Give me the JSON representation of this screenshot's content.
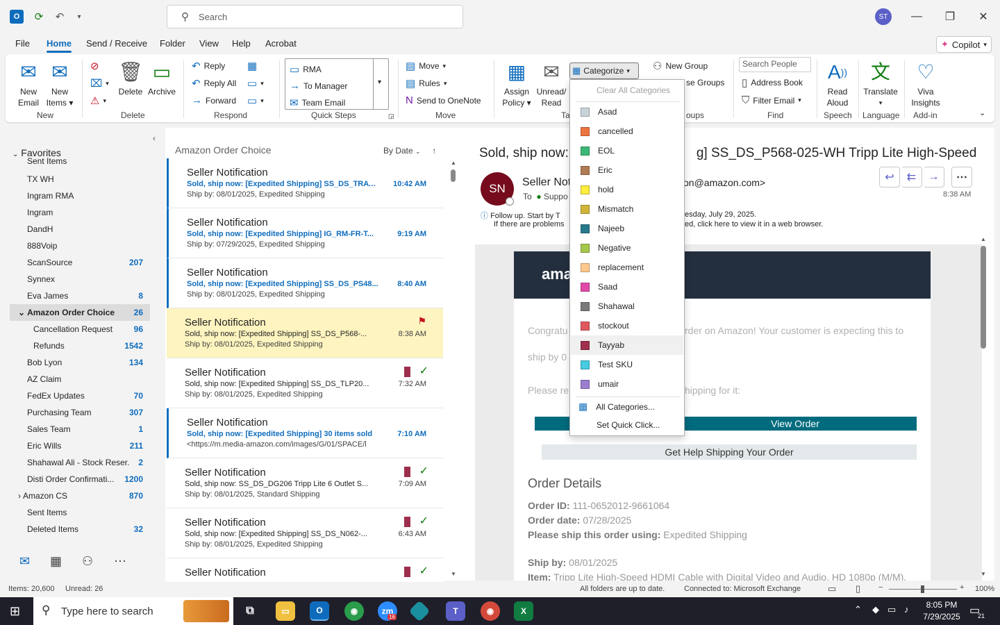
{
  "titlebar": {
    "search_placeholder": "Search",
    "avatar_initials": "ST"
  },
  "menu_tabs": [
    "File",
    "Home",
    "Send / Receive",
    "Folder",
    "View",
    "Help",
    "Acrobat"
  ],
  "copilot_label": "Copilot",
  "ribbon": {
    "new_email": [
      "New",
      "Email"
    ],
    "new_items": [
      "New",
      "Items"
    ],
    "group_new": "New",
    "delete": "Delete",
    "archive": "Archive",
    "group_delete": "Delete",
    "reply": "Reply",
    "reply_all": "Reply All",
    "forward": "Forward",
    "group_respond": "Respond",
    "quick_steps": [
      "RMA",
      "To Manager",
      "Team Email"
    ],
    "group_quick_steps": "Quick Steps",
    "move": "Move",
    "rules": "Rules",
    "send_to_onenote": "Send to OneNote",
    "group_move": "Move",
    "assign_policy": [
      "Assign",
      "Policy"
    ],
    "unread_read": [
      "Unread/",
      "Read"
    ],
    "group_tags_partial": "Ta",
    "categorize": "Categorize",
    "new_group": "New Group",
    "browse_groups_partial": "se Groups",
    "group_groups_partial": "oups",
    "search_people": "Search People",
    "address_book": "Address Book",
    "filter_email": "Filter Email",
    "group_find": "Find",
    "read_aloud": [
      "Read",
      "Aloud"
    ],
    "group_speech": "Speech",
    "translate": "Translate",
    "group_language": "Language",
    "viva_insights": [
      "Viva",
      "Insights"
    ],
    "group_addin": "Add-in"
  },
  "nav": {
    "favorites": "Favorites",
    "items": [
      {
        "label": "Sent Items",
        "count": ""
      },
      {
        "label": "TX WH",
        "count": ""
      },
      {
        "label": "Ingram RMA",
        "count": ""
      },
      {
        "label": "Ingram",
        "count": ""
      },
      {
        "label": "DandH",
        "count": ""
      },
      {
        "label": "888Voip",
        "count": ""
      },
      {
        "label": "ScanSource",
        "count": "207"
      },
      {
        "label": "Synnex",
        "count": ""
      },
      {
        "label": "Eva James",
        "count": "8"
      },
      {
        "label": "Amazon Order Choice",
        "count": "26"
      },
      {
        "label": "Cancellation Request",
        "count": "96"
      },
      {
        "label": "Refunds",
        "count": "1542"
      },
      {
        "label": "Bob Lyon",
        "count": "134"
      },
      {
        "label": "AZ Claim",
        "count": ""
      },
      {
        "label": "FedEx Updates",
        "count": "70"
      },
      {
        "label": "Purchasing Team",
        "count": "307"
      },
      {
        "label": "Sales Team",
        "count": "1"
      },
      {
        "label": "Eric Wills",
        "count": "211"
      },
      {
        "label": "Shahawal Ali - Stock Reser...",
        "count": "2"
      },
      {
        "label": "Disti Order Confirmati...",
        "count": "1200"
      },
      {
        "label": "Amazon CS",
        "count": "870"
      },
      {
        "label": "Sent Items",
        "count": ""
      },
      {
        "label": "Deleted Items",
        "count": "32"
      }
    ]
  },
  "list": {
    "folder": "Amazon Order Choice",
    "sort": "By Date",
    "messages": [
      {
        "sender": "Seller Notification",
        "subject": "Sold, ship now: [Expedited Shipping] SS_DS_TRAV...",
        "time": "10:42 AM",
        "preview": "Ship by: 08/01/2025, Expedited Shipping",
        "unread": true
      },
      {
        "sender": "Seller Notification",
        "subject": "Sold, ship now: [Expedited Shipping] IG_RM-FR-T...",
        "time": "9:19 AM",
        "preview": "Ship by: 07/29/2025, Expedited Shipping",
        "unread": true
      },
      {
        "sender": "Seller Notification",
        "subject": "Sold, ship now: [Expedited Shipping] SS_DS_PS48...",
        "time": "8:40 AM",
        "preview": "Ship by: 08/01/2025, Expedited Shipping",
        "unread": true
      },
      {
        "sender": "Seller Notification",
        "subject": "Sold, ship now: [Expedited Shipping] SS_DS_P568-...",
        "time": "8:38 AM",
        "preview": "Ship by: 08/01/2025, Expedited Shipping",
        "selected": true,
        "flag": true
      },
      {
        "sender": "Seller Notification",
        "subject": "Sold, ship now: [Expedited Shipping] SS_DS_TLP20...",
        "time": "7:32 AM",
        "preview": "Ship by: 08/01/2025, Expedited Shipping",
        "cat": true
      },
      {
        "sender": "Seller Notification",
        "subject": "Sold, ship now: [Expedited Shipping] 30 items sold",
        "time": "7:10 AM",
        "preview": "<https://m.media-amazon.com/images/G/01/SPACE/l",
        "unread": true
      },
      {
        "sender": "Seller Notification",
        "subject": "Sold, ship now: SS_DS_DG206 Tripp Lite 6 Outlet S...",
        "time": "7:09 AM",
        "preview": "Ship by: 08/01/2025, Standard Shipping",
        "cat": true
      },
      {
        "sender": "Seller Notification",
        "subject": "Sold, ship now: [Expedited Shipping] SS_DS_N062-...",
        "time": "6:43 AM",
        "preview": "Ship by: 08/01/2025, Expedited Shipping",
        "cat": true
      },
      {
        "sender": "Seller Notification",
        "subject": "",
        "time": "",
        "preview": "",
        "cat": true
      }
    ]
  },
  "reading": {
    "subject_left": "Sold, ship now:",
    "subject_right": "g] SS_DS_P568-025-WH Tripp Lite High-Speed H...",
    "avatar": "SN",
    "sender_partial": "Seller Noti",
    "to_label": "To",
    "to_partial": "Suppo",
    "sender_email_partial": "on@amazon.com>",
    "time": "8:38 AM",
    "followup_left": "Follow up.  Start by T",
    "followup_right": "esday, July 29, 2025.",
    "problems_left": "If there are problems",
    "problems_right": "ed, click here to view it in a web browser.",
    "amazon_partial": "ama",
    "congrats_left": "Congratu",
    "congrats_right": "rder on Amazon! Your customer is expecting this to",
    "shipby_partial": "ship by 0",
    "please_left": "Please re",
    "please_right": "hipping for it:",
    "view_order": "View Order",
    "get_help": "Get Help Shipping Your Order",
    "order_details": "Order Details",
    "order_id_label": "Order ID:",
    "order_id": "111-0652012-9661064",
    "order_date_label": "Order date:",
    "order_date": "07/28/2025",
    "ship_using_label": "Please ship this order using:",
    "ship_using": "Expedited Shipping",
    "ship_by_label": "Ship by:",
    "ship_by": "08/01/2025",
    "item_label": "Item:",
    "item": "Tripp Lite High-Speed HDMI Cable with Digital Video and Audio, HD 1080p (M/M),"
  },
  "categorize_menu": {
    "clear_all": "Clear All Categories",
    "categories": [
      {
        "name": "Asad",
        "color": "#c9d3d8"
      },
      {
        "name": "cancelled",
        "color": "#ec7440"
      },
      {
        "name": "EOL",
        "color": "#3cb877"
      },
      {
        "name": "Eric",
        "color": "#b07c54"
      },
      {
        "name": "hold",
        "color": "#ffec3d"
      },
      {
        "name": "Mismatch",
        "color": "#d0b53a"
      },
      {
        "name": "Najeeb",
        "color": "#277a8c"
      },
      {
        "name": "Negative",
        "color": "#a4c64a"
      },
      {
        "name": "replacement",
        "color": "#ffc88c"
      },
      {
        "name": "Saad",
        "color": "#e14aa8"
      },
      {
        "name": "Shahawal",
        "color": "#7a7a7a"
      },
      {
        "name": "stockout",
        "color": "#e0585e"
      },
      {
        "name": "Tayyab",
        "color": "#a0304e"
      },
      {
        "name": "Test SKU",
        "color": "#46cbe0"
      },
      {
        "name": "umair",
        "color": "#9c7ed0"
      }
    ],
    "all_categories": "All Categories...",
    "set_quick_click": "Set Quick Click..."
  },
  "status": {
    "items": "Items: 20,600",
    "unread": "Unread: 26",
    "uptodate": "All folders are up to date.",
    "connected": "Connected to: Microsoft Exchange",
    "zoom": "100%"
  },
  "taskbar": {
    "search_placeholder": "Type here to search",
    "time": "8:05 PM",
    "date": "7/29/2025",
    "zoom_badge": "16",
    "notif_count": "21"
  }
}
